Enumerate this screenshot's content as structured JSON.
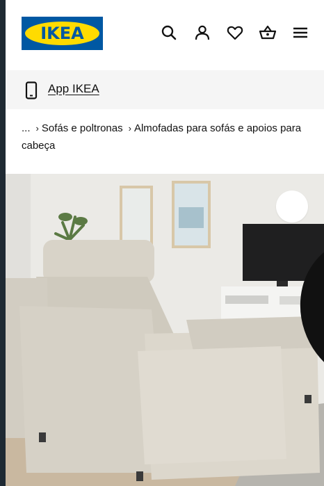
{
  "header": {
    "logo_text": "IKEA",
    "icons": [
      "search-icon",
      "user-icon",
      "heart-icon",
      "basket-icon",
      "menu-icon"
    ]
  },
  "app_banner": {
    "icon": "phone-icon",
    "label": "App IKEA"
  },
  "breadcrumb": {
    "ellipsis": "...",
    "items": [
      "Sofás e poltronas",
      "Almofadas para sofás e apoios para cabeça"
    ]
  },
  "product_image": {
    "favorite_icon": "heart-icon"
  },
  "colors": {
    "brand_blue": "#0058a3",
    "brand_yellow": "#ffdb00",
    "banner_bg": "#f5f5f5"
  }
}
